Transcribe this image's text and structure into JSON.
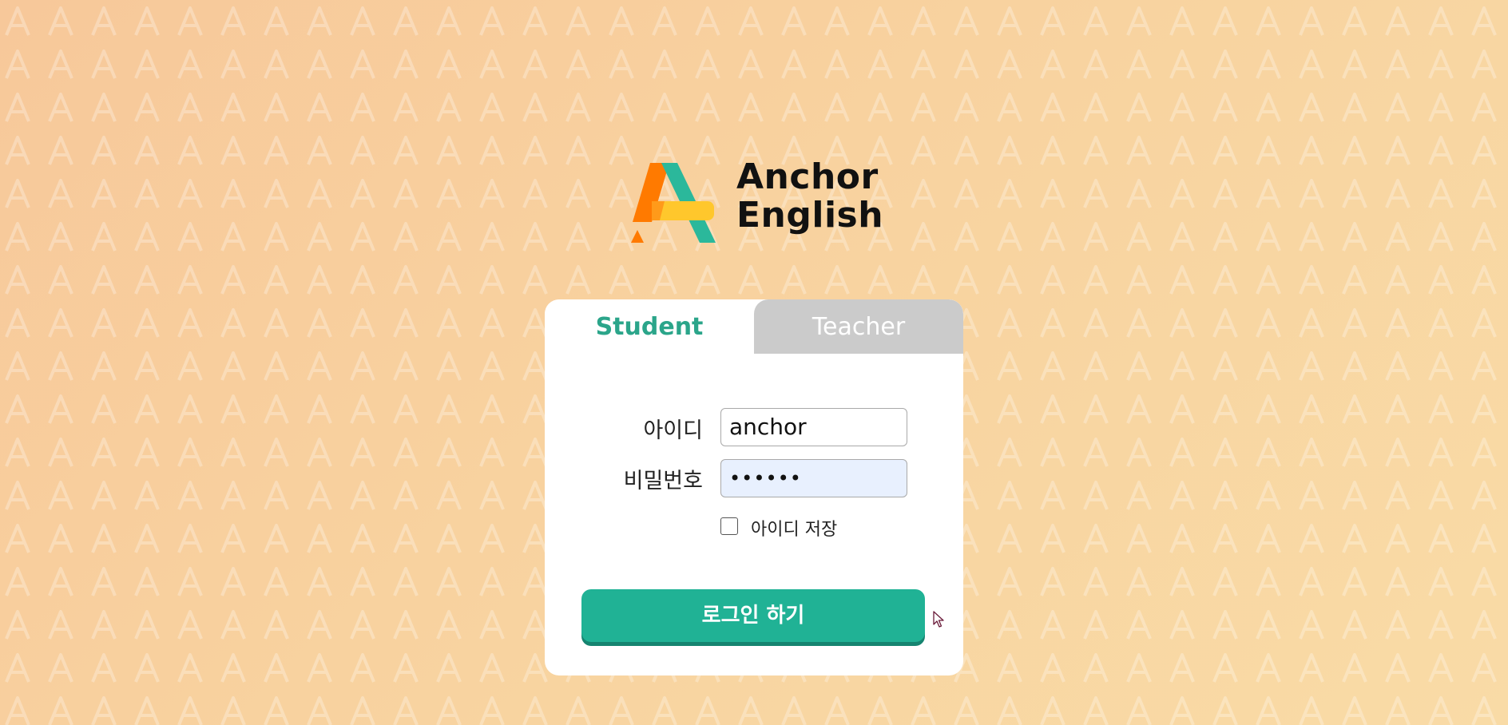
{
  "brand": {
    "line1": "Anchor",
    "line2": "English",
    "colors": {
      "orange": "#ff7a00",
      "teal": "#2bb89b",
      "yellow": "#ffc72c"
    }
  },
  "tabs": [
    {
      "label": "Student",
      "active": true
    },
    {
      "label": "Teacher",
      "active": false
    }
  ],
  "form": {
    "id_label": "아이디",
    "id_value": "anchor",
    "pw_label": "비밀번호",
    "pw_value": "••••••",
    "remember_label": "아이디 저장",
    "remember_checked": false,
    "submit_label": "로그인 하기"
  },
  "theme": {
    "accent": "#20b295",
    "background": "#f8cf9e",
    "inactive_tab": "#cbcbcb",
    "autofill": "#e8f0fe"
  }
}
